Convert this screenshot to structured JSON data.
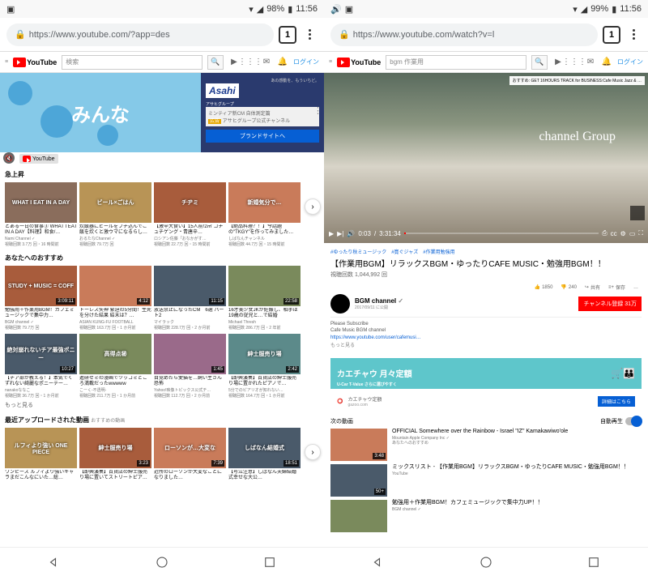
{
  "left": {
    "status": {
      "battery": "98%",
      "time": "11:56"
    },
    "url": "https://www.youtube.com/?app=des",
    "tabs": "1",
    "brand": "YouTube",
    "search_placeholder": "検索",
    "login": "ログイン",
    "ad": {
      "main_text": "みんな",
      "logo": "Asahi",
      "logo_sub": "アサヒグループ",
      "line1": "ミンティア新CM 自体測定篇",
      "line2": "アサヒグループ公式チャンネル",
      "badge": "広告",
      "button": "ブランドサイトへ",
      "yt_tag": "YouTube"
    },
    "section1": "急上昇",
    "row1": [
      {
        "overlay": "WHAT I EAT IN A DAY",
        "dur": "",
        "title": "とある一日の食事③ WHAT I EAT IN A DAY【料理】和食/…",
        "ch": "Nami Channel ✓",
        "meta": "視聴回数 3.7万 回・16 時間前"
      },
      {
        "overlay": "ビール×ごはん",
        "dur": "",
        "title": "炊飯器にビールをブチ込んでご飯を炊くと激ウマになるらし…",
        "ch": "おるたなChannel ✓",
        "meta": "視聴回数 79.7万 回"
      },
      {
        "overlay": "チヂミ",
        "dur": "",
        "title": "【激辛大食い】15人前!2㎡ コチュチゲング・青唐辛…",
        "ch": "ロシアン佐藤「おなかがす…",
        "meta": "視聴回数 22.7万 回・15 時間前"
      },
      {
        "overlay": "新婚気分で…",
        "dur": "",
        "title": "【絶品料理？！】今話題の″TKGY″を作ってみました…",
        "ch": "しばなんチャンネル",
        "meta": "視聴回数 44.7万 回・15 時間前"
      }
    ],
    "section2": "あなたへのおすすめ",
    "row2": [
      {
        "overlay": "STUDY + MUSIC = COFF",
        "dur": "3:09:11",
        "title": "勉強用＋作業用BGM！カフェミュージックで集中力…",
        "ch": "BGM channel ✓",
        "meta": "視聴回数 79.7万 回"
      },
      {
        "overlay": "",
        "dur": "4:12",
        "title": "トーレス矢神 緊迫の5分間！生死を分けた結果 結末は？…",
        "ch": "ASIAN KUNG-FU FOOTBALL",
        "meta": "視聴回数 163.7万 回・1 か月前"
      },
      {
        "overlay": "",
        "dur": "11:15",
        "title": "放送禁止になったCM　6選 パート2",
        "ch": "マイラック",
        "meta": "視聴回数 228.7万 回・2 か月前"
      },
      {
        "overlay": "",
        "dur": "22:58",
        "title": "16才美少女JKが妊娠し、相手は19歳の従兄と…で結婚",
        "ch": "Michael Thresh",
        "meta": "視聴回数 286.7万 回・2 年前"
      }
    ],
    "row3": [
      {
        "overlay": "絶対崩れないチア最強ポニー",
        "dur": "10:27",
        "title": "【チア部が教える！】本気でくずれない綺麗なポニーテー…",
        "ch": "nanakoななこ",
        "meta": "視聴回数 36.7万 回・1 か月前"
      },
      {
        "overlay": "高得点㊙",
        "dur": "",
        "title": "進研ゼミの漫画でツッコミどころ満載だったwwwww",
        "ch": "こーく-不透明-",
        "meta": "視聴回数 211.7万 回・1 か月前"
      },
      {
        "overlay": "",
        "dur": "1:45",
        "title": "目覚めたら愛猫を…飼い主さん恐怖",
        "ch": "Yahoo!映像トピックス公式チ…",
        "meta": "視聴回数 112.7万 回・2 か月前"
      },
      {
        "overlay": "紳士服売り場",
        "dur": "2:42",
        "title": "【即興演奏】百貨店の紳士服売り場に置かれたピアノで…",
        "ch": "5分でのピアリオが知れない…",
        "meta": "視聴回数 164.7万 回・1 か月前"
      }
    ],
    "more": "もっと見る",
    "section3": "最近アップロードされた動画",
    "section3_sub": "おすすめの動画",
    "row4": [
      {
        "overlay": "ルフィより強い ONE PIECE",
        "dur": "",
        "title": "ワンピース ルフィより強いキャラまだこんなにいた…総…",
        "ch": "",
        "meta": ""
      },
      {
        "overlay": "紳士服売り場",
        "dur": "3:23",
        "title": "【即興演奏】百貨店の紳士服売り場に置いてストリートピア…",
        "ch": "",
        "meta": ""
      },
      {
        "overlay": "ローソンが…大変な",
        "dur": "7:39",
        "title": "近所のローソンが大変なことになりました…",
        "ch": "",
        "meta": ""
      },
      {
        "overlay": "しばなん結婚式",
        "dur": "18:51",
        "title": "【号泣注意】しばなん夫婦結婚式幸せな大公…",
        "ch": "",
        "meta": ""
      }
    ]
  },
  "right": {
    "status": {
      "battery": "99%",
      "time": "11:56"
    },
    "url": "https://www.youtube.com/watch?v=l",
    "tabs": "1",
    "brand": "YouTube",
    "search_value": "bgm 作業用",
    "login": "ログイン",
    "player": {
      "recommend": "おすすめ: GET 16HOURS TRACK for BUSINESS:Cafe Music Jazz & …",
      "channel_text": "channel Group",
      "current": "0:03",
      "total": "3:31:34"
    },
    "tags": "#ゆったり秋ミュージック　#寛ぐジャズ　#作業用勉強用",
    "title": "【作業用BGM】リラックスBGM・ゆったりCAFE MUSIC・勉強用BGM！！",
    "views": "視聴回数 1,044,992 回",
    "likes": "1850",
    "dislikes": "240",
    "share": "共有",
    "save": "保存",
    "channel": {
      "name": "BGM channel",
      "date": "2017/09/11 に公開",
      "subscribe": "チャンネル登録 31万"
    },
    "desc": {
      "line1": "Please Subscribe",
      "line2": "Cafe Music BGM channel",
      "link": "https://www.youtube.com/user/cafemusi…",
      "more": "もっと見る"
    },
    "promo": {
      "title": "カエチャウ 月々定額",
      "sub": "U-Car T-Value さらに選びやすく",
      "brand": "カエチャウ定額",
      "site": "gazoo.com",
      "button": "詳細はこちら"
    },
    "next_label": "次の動画",
    "autoplay": "自動再生",
    "next": [
      {
        "title": "OFFICIAL Somewhere over the Rainbow - Israel \"IZ\" Kamakawiwo'ole",
        "ch": "Mountain Apple Company Inc ✓",
        "meta": "あなたへのおすすめ",
        "dur": "3:48"
      },
      {
        "title": "ミックスリスト - 【作業用BGM】リラックスBGM・ゆったりCAFE MUSIC・勉強用BGM！！",
        "ch": "YouTube",
        "meta": "",
        "dur": "50+"
      },
      {
        "title": "勉強用＋作業用BGM！カフェミュージックで集中力UP！！",
        "ch": "BGM channel ✓",
        "meta": "",
        "dur": ""
      }
    ]
  }
}
